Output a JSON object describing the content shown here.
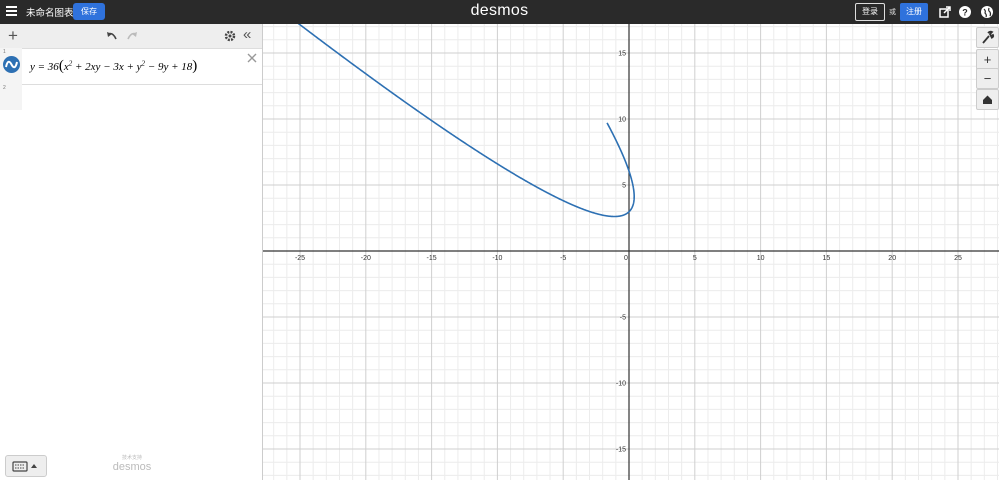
{
  "header": {
    "graph_title": "未命名图表",
    "save_label": "保存",
    "logo": "desmos",
    "login_label": "登录",
    "or_label": "或",
    "signup_label": "注册"
  },
  "expressions": [
    {
      "index": "1",
      "latex": "y=36(x^2+2xy-3x+y^2-9y+18)",
      "color": "#2d70b3",
      "prefix": "y = 36",
      "terms": {
        "t1": "x",
        "t2": " + 2xy − 3x + y",
        "t3": " − 9y + 18"
      },
      "exp": "2"
    },
    {
      "index": "2"
    }
  ],
  "footer": {
    "powered_by": "技术支持",
    "brand": "desmos"
  },
  "graph": {
    "xrange": [
      -28,
      28
    ],
    "yrange": [
      -17,
      17
    ],
    "x_tick_labels": [
      "-25",
      "-20",
      "-15",
      "-10",
      "-5",
      "0",
      "5",
      "10",
      "15",
      "20",
      "25"
    ],
    "y_tick_labels": [
      "15",
      "10",
      "5",
      "-5",
      "-10",
      "-15"
    ],
    "curve_color": "#2d70b3"
  },
  "icons": [
    "menu-icon",
    "share-icon",
    "help-icon",
    "language-globe-icon",
    "add-icon",
    "undo-icon",
    "redo-icon",
    "settings-gear-icon",
    "collapse-panel-icon",
    "delete-icon",
    "keyboard-icon",
    "wrench-icon",
    "zoom-in-icon",
    "zoom-out-icon",
    "home-icon"
  ]
}
